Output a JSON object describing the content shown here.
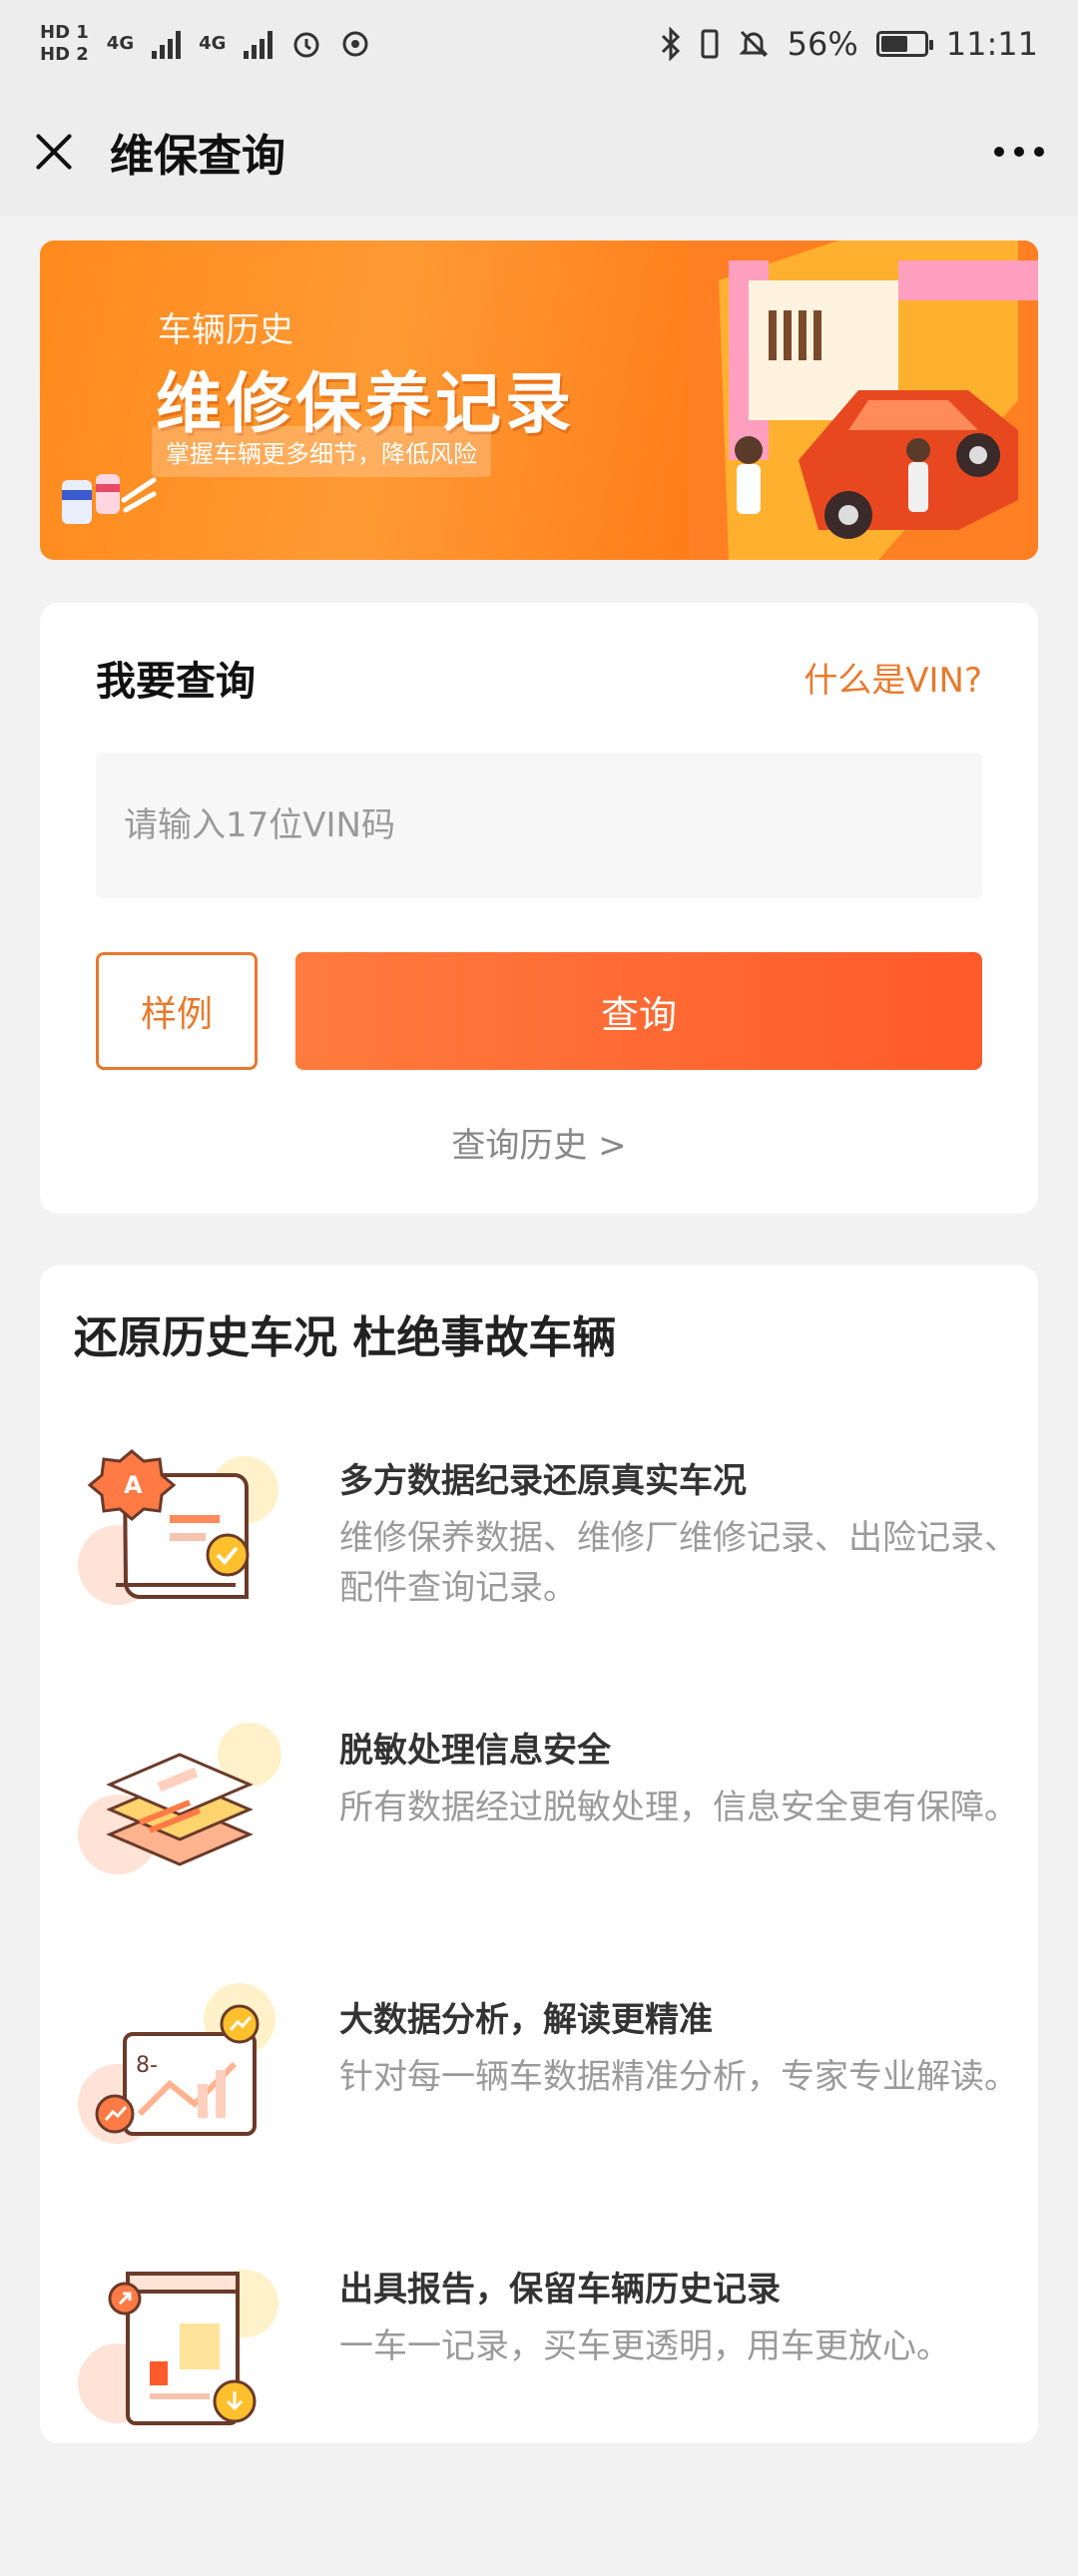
{
  "status_bar": {
    "hd1": "HD 1",
    "hd2": "HD 2",
    "net1": "4G",
    "net2": "4G",
    "battery_percent": "56%",
    "time": "11:11",
    "battery_level": 0.56
  },
  "nav": {
    "title": "维保查询"
  },
  "banner": {
    "subtitle": "车辆历史",
    "title": "维修保养记录",
    "tagline": "掌握车辆更多细节，降低风险"
  },
  "query": {
    "title": "我要查询",
    "vin_link": "什么是VIN?",
    "input_placeholder": "请输入17位VIN码",
    "input_value": "",
    "sample_label": "样例",
    "query_label": "查询",
    "history_label": "查询历史 >"
  },
  "features": {
    "heading": "还原历史车况 杜绝事故车辆",
    "items": [
      {
        "title": "多方数据纪录还原真实车况",
        "desc": "维修保养数据、维修厂维修记录、出险记录、配件查询记录。",
        "icon": "document-badge-icon"
      },
      {
        "title": "脱敏处理信息安全",
        "desc": "所有数据经过脱敏处理，信息安全更有保障。",
        "icon": "layers-icon"
      },
      {
        "title": "大数据分析，解读更精准",
        "desc": "针对每一辆车数据精准分析，专家专业解读。",
        "icon": "chart-analysis-icon"
      },
      {
        "title": "出具报告，保留车辆历史记录",
        "desc": "一车一记录，买车更透明，用车更放心。",
        "icon": "report-download-icon"
      }
    ]
  },
  "colors": {
    "accent": "#e8792d",
    "button_gradient_start": "#ff7b3e",
    "button_gradient_end": "#ff5a2a",
    "banner_orange": "#ff8a1d"
  }
}
